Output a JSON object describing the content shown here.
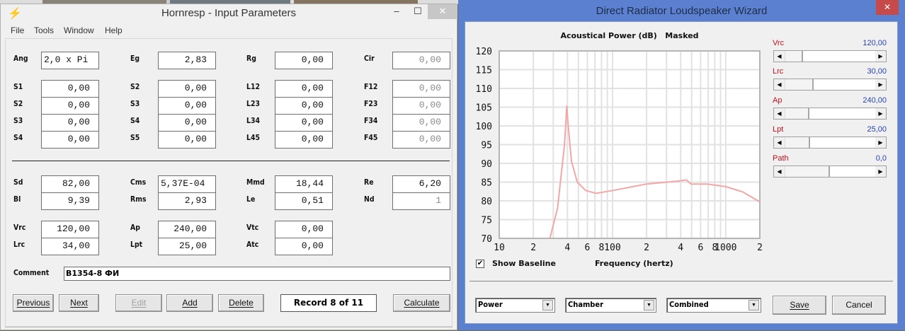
{
  "left_window": {
    "title": "Hornresp - Input Parameters",
    "controls": {
      "minimize": "–",
      "maximize": "☐",
      "close": "✕"
    },
    "menu": [
      "File",
      "Tools",
      "Window",
      "Help"
    ],
    "fields": [
      {
        "label": "Ang",
        "value": "2,0 x Pi",
        "disabled": false,
        "align": "left"
      },
      {
        "label": "Eg",
        "value": "2,83",
        "disabled": false
      },
      {
        "label": "Rg",
        "value": "0,00",
        "disabled": false
      },
      {
        "label": "Cir",
        "value": "0,00",
        "disabled": true
      },
      {
        "label": "S1",
        "value": "0,00",
        "disabled": false
      },
      {
        "label": "S2",
        "value": "0,00",
        "disabled": false
      },
      {
        "label": "L12",
        "value": "0,00",
        "disabled": false
      },
      {
        "label": "F12",
        "value": "0,00",
        "disabled": true
      },
      {
        "label": "S2",
        "value": "0,00",
        "disabled": false
      },
      {
        "label": "S3",
        "value": "0,00",
        "disabled": false
      },
      {
        "label": "L23",
        "value": "0,00",
        "disabled": false
      },
      {
        "label": "F23",
        "value": "0,00",
        "disabled": true
      },
      {
        "label": "S3",
        "value": "0,00",
        "disabled": false
      },
      {
        "label": "S4",
        "value": "0,00",
        "disabled": false
      },
      {
        "label": "L34",
        "value": "0,00",
        "disabled": false
      },
      {
        "label": "F34",
        "value": "0,00",
        "disabled": true
      },
      {
        "label": "S4",
        "value": "0,00",
        "disabled": false
      },
      {
        "label": "S5",
        "value": "0,00",
        "disabled": false
      },
      {
        "label": "L45",
        "value": "0,00",
        "disabled": false
      },
      {
        "label": "F45",
        "value": "0,00",
        "disabled": true
      },
      {
        "label": "Sd",
        "value": "82,00",
        "disabled": false
      },
      {
        "label": "Cms",
        "value": "5,37E-04",
        "disabled": false,
        "align": "left"
      },
      {
        "label": "Mmd",
        "value": "18,44",
        "disabled": false
      },
      {
        "label": "Re",
        "value": "6,20",
        "disabled": false
      },
      {
        "label": "Bl",
        "value": "9,39",
        "disabled": false
      },
      {
        "label": "Rms",
        "value": "2,93",
        "disabled": false
      },
      {
        "label": "Le",
        "value": "0,51",
        "disabled": false
      },
      {
        "label": "Nd",
        "value": "1",
        "disabled": true
      },
      {
        "label": "Vrc",
        "value": "120,00",
        "disabled": false
      },
      {
        "label": "Ap",
        "value": "240,00",
        "disabled": false
      },
      {
        "label": "Vtc",
        "value": "0,00",
        "disabled": false
      },
      {
        "label": "Lrc",
        "value": "34,00",
        "disabled": false
      },
      {
        "label": "Lpt",
        "value": "25,00",
        "disabled": false
      },
      {
        "label": "Atc",
        "value": "0,00",
        "disabled": false
      }
    ],
    "comment": {
      "label": "Comment",
      "value": "B1354-8 ФИ"
    },
    "buttons": {
      "previous": "Previous",
      "next": "Next",
      "edit": "Edit",
      "add": "Add",
      "delete": "Delete",
      "calculate": "Calculate"
    },
    "record": "Record 8 of 11"
  },
  "right_window": {
    "title": "Direct Radiator Loudspeaker Wizard",
    "close": "✕",
    "sliders": [
      {
        "label": "Vrc",
        "value": "120,00",
        "level": 0.2
      },
      {
        "label": "Lrc",
        "value": "30,00",
        "level": 0.32
      },
      {
        "label": "Ap",
        "value": "240,00",
        "level": 0.27
      },
      {
        "label": "Lpt",
        "value": "25,00",
        "level": 0.28
      },
      {
        "label": "Path",
        "value": "0,0",
        "level": 0.5
      }
    ],
    "show_baseline": {
      "label": "Show Baseline",
      "checked": true
    },
    "dropdowns": [
      "Power",
      "Chamber",
      "Combined"
    ],
    "save": "Save",
    "cancel": "Cancel"
  },
  "chart_data": {
    "type": "line",
    "title": "Acoustical Power (dB)   Masked",
    "xlabel": "Frequency (hertz)",
    "ylabel": "",
    "xscale": "log",
    "xlim": [
      10,
      2000
    ],
    "ylim": [
      70,
      120
    ],
    "grid": true,
    "xticks": [
      {
        "v": 10,
        "t": "10"
      },
      {
        "v": 20,
        "t": "2"
      },
      {
        "v": 40,
        "t": "4"
      },
      {
        "v": 60,
        "t": "6"
      },
      {
        "v": 80,
        "t": "8"
      },
      {
        "v": 100,
        "t": "100"
      },
      {
        "v": 200,
        "t": "2"
      },
      {
        "v": 400,
        "t": "4"
      },
      {
        "v": 600,
        "t": "6"
      },
      {
        "v": 800,
        "t": "8"
      },
      {
        "v": 1000,
        "t": "1000"
      },
      {
        "v": 2000,
        "t": "2"
      }
    ],
    "yticks": [
      70,
      75,
      80,
      85,
      90,
      95,
      100,
      105,
      110,
      115,
      120
    ],
    "color": "#f2a7a7",
    "x": [
      28,
      32.7,
      37.7,
      39.5,
      40.5,
      43.4,
      48.9,
      57.8,
      71.6,
      102,
      199,
      389,
      449,
      494,
      689,
      1000,
      1409,
      1986
    ],
    "y": [
      70,
      78,
      95,
      105.4,
      100.7,
      90.6,
      85,
      82.8,
      82,
      82.8,
      84.5,
      85.3,
      85.6,
      84.5,
      84.5,
      83.8,
      82.4,
      79.8
    ]
  }
}
